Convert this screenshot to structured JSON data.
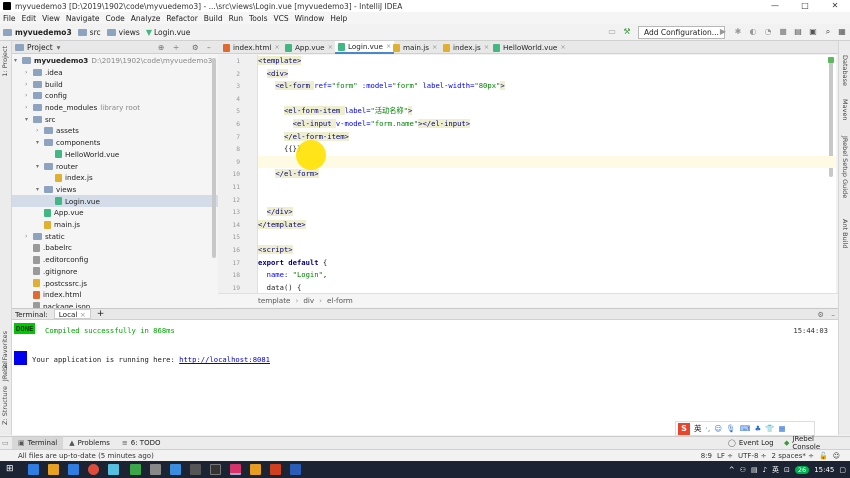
{
  "window": {
    "title": "myvuedemo3 [D:\\2019\\1902\\code\\myvuedemo3] - ...\\src\\views\\Login.vue [myvuedemo3] - IntelliJ IDEA",
    "controls": [
      "—",
      "□",
      "✕"
    ]
  },
  "menu": [
    "File",
    "Edit",
    "View",
    "Navigate",
    "Code",
    "Analyze",
    "Refactor",
    "Build",
    "Run",
    "Tools",
    "VCS",
    "Window",
    "Help"
  ],
  "toolbar": {
    "breadcrumbs": [
      "myvuedemo3",
      "src",
      "views",
      "Login.vue"
    ],
    "add_configuration": "Add Configuration..."
  },
  "left_strip": {
    "project": "1: Project",
    "favorites": "2: Favorites",
    "jrebel": "JRebel",
    "structure": "Z: Structure"
  },
  "right_strip": {
    "database": "Database",
    "maven": "Maven",
    "jrebel_setup": "JRebel Setup Guide",
    "ant": "Ant Build"
  },
  "project_panel": {
    "header": "Project",
    "tree": [
      {
        "name": "myvuedemo3",
        "extra": "D:\\2019\\1902\\code\\myvuedemo3",
        "type": "folder",
        "indent": 0,
        "arrow": "▾",
        "bold": true
      },
      {
        "name": ".idea",
        "type": "folder",
        "indent": 1,
        "arrow": "›"
      },
      {
        "name": "build",
        "type": "folder",
        "indent": 1,
        "arrow": "›"
      },
      {
        "name": "config",
        "type": "folder",
        "indent": 1,
        "arrow": "›"
      },
      {
        "name": "node_modules",
        "extra": "library root",
        "type": "folder",
        "indent": 1,
        "arrow": "›"
      },
      {
        "name": "src",
        "type": "folder",
        "indent": 1,
        "arrow": "▾"
      },
      {
        "name": "assets",
        "type": "folder",
        "indent": 2,
        "arrow": "›"
      },
      {
        "name": "components",
        "type": "folder",
        "indent": 2,
        "arrow": "▾"
      },
      {
        "name": "HelloWorld.vue",
        "type": "vue",
        "indent": 3,
        "arrow": ""
      },
      {
        "name": "router",
        "type": "folder",
        "indent": 2,
        "arrow": "▾"
      },
      {
        "name": "index.js",
        "type": "js",
        "indent": 3,
        "arrow": ""
      },
      {
        "name": "views",
        "type": "folder",
        "indent": 2,
        "arrow": "▾"
      },
      {
        "name": "Login.vue",
        "type": "vue",
        "indent": 3,
        "arrow": "",
        "selected": true
      },
      {
        "name": "App.vue",
        "type": "vue",
        "indent": 2,
        "arrow": ""
      },
      {
        "name": "main.js",
        "type": "js",
        "indent": 2,
        "arrow": ""
      },
      {
        "name": "static",
        "type": "folder",
        "indent": 1,
        "arrow": "›"
      },
      {
        "name": ".babelrc",
        "type": "file",
        "indent": 1,
        "arrow": ""
      },
      {
        "name": ".editorconfig",
        "type": "file",
        "indent": 1,
        "arrow": ""
      },
      {
        "name": ".gitignore",
        "type": "file",
        "indent": 1,
        "arrow": ""
      },
      {
        "name": ".postcssrc.js",
        "type": "js",
        "indent": 1,
        "arrow": ""
      },
      {
        "name": "index.html",
        "type": "html",
        "indent": 1,
        "arrow": ""
      },
      {
        "name": "package.json",
        "type": "file",
        "indent": 1,
        "arrow": ""
      }
    ]
  },
  "editor": {
    "tabs": [
      {
        "label": "index.html",
        "type": "html"
      },
      {
        "label": "App.vue",
        "type": "vue"
      },
      {
        "label": "Login.vue",
        "type": "vue",
        "active": true
      },
      {
        "label": "main.js",
        "type": "js"
      },
      {
        "label": "index.js",
        "type": "js"
      },
      {
        "label": "HelloWorld.vue",
        "type": "vue"
      }
    ],
    "line_numbers": [
      "1",
      "2",
      "3",
      "4",
      "5",
      "6",
      "7",
      "8",
      "9",
      "10",
      "11",
      "12",
      "13",
      "14",
      "15",
      "16",
      "17",
      "18",
      "19"
    ],
    "current_line": 9,
    "lines": [
      [
        {
          "t": "tag",
          "v": "<template>"
        }
      ],
      [
        {
          "t": "pad",
          "v": "  "
        },
        {
          "t": "tag",
          "v": "<div>"
        }
      ],
      [
        {
          "t": "pad",
          "v": "    "
        },
        {
          "t": "tag",
          "v": "<el-form "
        },
        {
          "t": "attr",
          "v": "ref="
        },
        {
          "t": "str",
          "v": "\"form\""
        },
        {
          "t": "attr",
          "v": " :model="
        },
        {
          "t": "str",
          "v": "\"form\""
        },
        {
          "t": "attr",
          "v": " label-width="
        },
        {
          "t": "str",
          "v": "\"80px\""
        },
        {
          "t": "tag",
          "v": ">"
        }
      ],
      [
        {
          "t": "pad",
          "v": ""
        }
      ],
      [
        {
          "t": "pad",
          "v": "      "
        },
        {
          "t": "tag",
          "v": "<el-form-item "
        },
        {
          "t": "attr",
          "v": "label="
        },
        {
          "t": "str",
          "v": "\"活动名称\""
        },
        {
          "t": "tag",
          "v": ">"
        }
      ],
      [
        {
          "t": "pad",
          "v": "        "
        },
        {
          "t": "tag",
          "v": "<el-input "
        },
        {
          "t": "attr",
          "v": "v-model="
        },
        {
          "t": "str",
          "v": "\"form.name\""
        },
        {
          "t": "tag",
          "v": "></el-input>"
        }
      ],
      [
        {
          "t": "pad",
          "v": "      "
        },
        {
          "t": "tag",
          "v": "</el-form-item>"
        }
      ],
      [
        {
          "t": "pad",
          "v": "      "
        },
        {
          "t": "plain",
          "v": "{{}}"
        }
      ],
      [
        {
          "t": "pad",
          "v": ""
        }
      ],
      [
        {
          "t": "pad",
          "v": "    "
        },
        {
          "t": "tag",
          "v": "</el-form>"
        }
      ],
      [
        {
          "t": "pad",
          "v": ""
        }
      ],
      [
        {
          "t": "pad",
          "v": ""
        }
      ],
      [
        {
          "t": "pad",
          "v": "  "
        },
        {
          "t": "tag",
          "v": "</div>"
        }
      ],
      [
        {
          "t": "tag",
          "v": "</template>"
        }
      ],
      [
        {
          "t": "pad",
          "v": ""
        }
      ],
      [
        {
          "t": "tag",
          "v": "<script>"
        }
      ],
      [
        {
          "t": "kw",
          "v": "export default "
        },
        {
          "t": "plain",
          "v": "{"
        }
      ],
      [
        {
          "t": "pad",
          "v": "  "
        },
        {
          "t": "attr",
          "v": "name"
        },
        {
          "t": "plain",
          "v": ": "
        },
        {
          "t": "str",
          "v": "\"Login\""
        },
        {
          "t": "plain",
          "v": ","
        }
      ],
      [
        {
          "t": "pad",
          "v": "  "
        },
        {
          "t": "plain",
          "v": "data() {"
        }
      ]
    ],
    "breadcrumb": [
      "template",
      "div",
      "el-form"
    ]
  },
  "terminal": {
    "label": "Terminal:",
    "tab": "Local",
    "add": "+",
    "done_badge": "DONE",
    "compiled": "Compiled successfully in 868ms",
    "time": "15:44:03",
    "running_prefix": "Your application is running here: ",
    "url": "http://localhost:8081"
  },
  "ime": {
    "logo": "S",
    "lang": "英"
  },
  "bottom_tabs": [
    {
      "label": "Terminal",
      "active": true
    },
    {
      "label": "Problems"
    },
    {
      "label": "6: TODO"
    }
  ],
  "bottom_right_tabs": [
    "Event Log",
    "JRebel Console"
  ],
  "status": {
    "message": "All files are up-to-date (5 minutes ago)",
    "position": "8:9",
    "line_sep": "LF ÷",
    "encoding": "UTF-8 ÷",
    "indent": "2 spaces* ÷"
  },
  "taskbar": {
    "tray_lang": "英",
    "time": "15:45",
    "bubble": "26"
  },
  "colors": {
    "accent": "#4a88c7",
    "vue": "#41b883",
    "done": "#00c800",
    "cursor_highlight": "#ffe100"
  }
}
